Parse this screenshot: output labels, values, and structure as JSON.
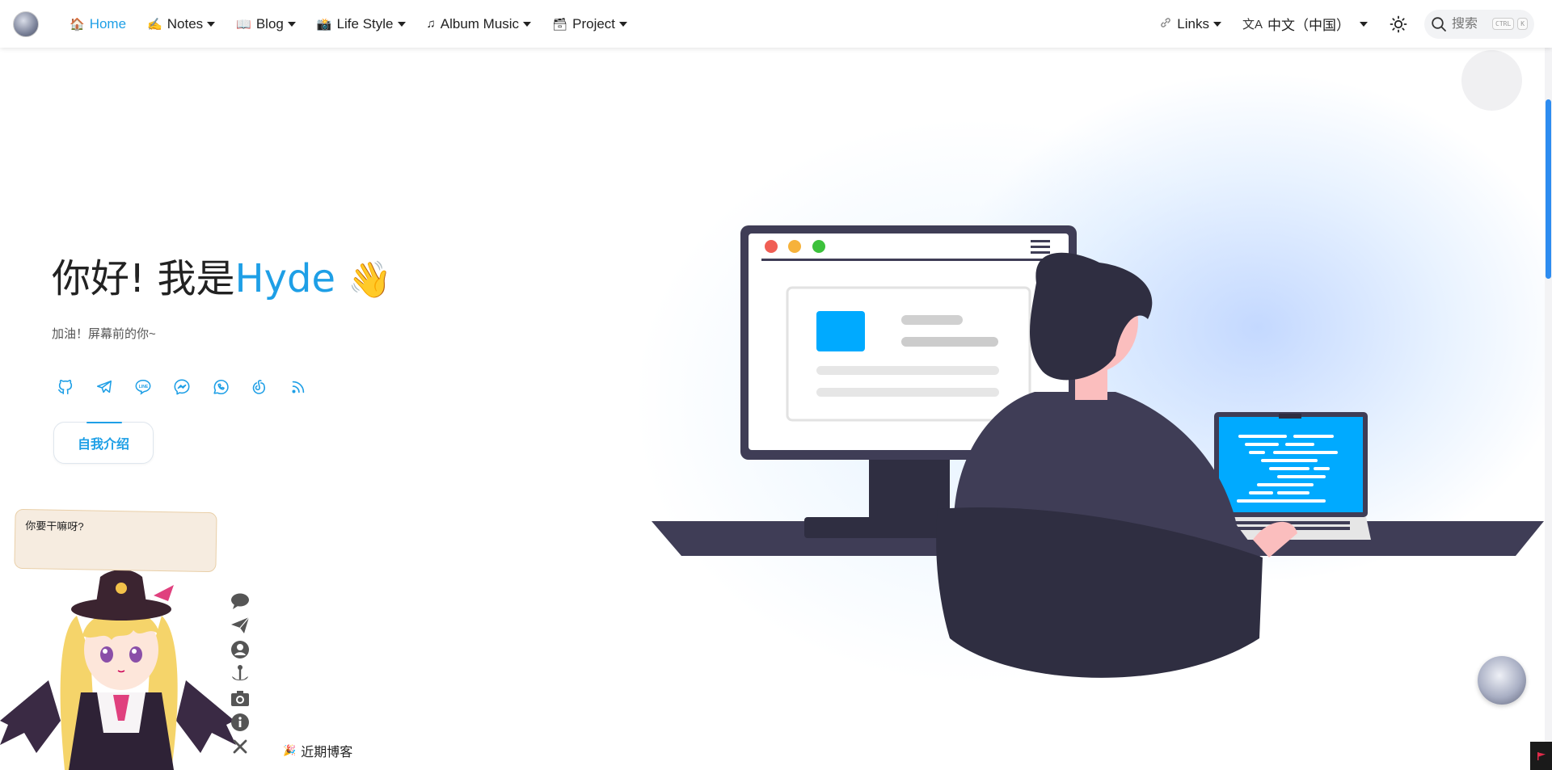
{
  "nav": {
    "items": [
      {
        "emoji": "🏠",
        "label": "Home",
        "active": true,
        "dropdown": false
      },
      {
        "emoji": "✍️",
        "label": "Notes",
        "active": false,
        "dropdown": true
      },
      {
        "emoji": "📖",
        "label": "Blog",
        "active": false,
        "dropdown": true
      },
      {
        "emoji": "📸",
        "label": "Life Style",
        "active": false,
        "dropdown": true
      },
      {
        "emoji": "♫",
        "label": "Album Music",
        "active": false,
        "dropdown": true
      },
      {
        "emoji": "🗃",
        "label": "Project",
        "active": false,
        "dropdown": true
      }
    ],
    "links_label": "Links",
    "language_label": "中文（中国）",
    "search_placeholder": "搜索",
    "search_kbd_1": "CTRL",
    "search_kbd_2": "K"
  },
  "hero": {
    "greeting": "你好! 我是",
    "name": "Hyde",
    "wave": "👋",
    "subtitle": "加油！屏幕前的你~",
    "intro_button": "自我介绍",
    "social_icons": [
      "github-icon",
      "telegram-icon",
      "line-icon",
      "messenger-icon",
      "whatsapp-icon",
      "netease-music-icon",
      "rss-icon"
    ]
  },
  "mascot": {
    "bubble_text": "你要干嘛呀?",
    "tool_icons": [
      "chat-icon",
      "send-icon",
      "user-icon",
      "anchor-icon",
      "camera-icon",
      "info-icon",
      "close-icon"
    ]
  },
  "footer": {
    "recent_label": "近期博客",
    "recent_emoji": "🎉"
  },
  "colors": {
    "accent": "#1e9fe6",
    "screen_blue": "#00aaff",
    "dark": "#2f2e41"
  }
}
